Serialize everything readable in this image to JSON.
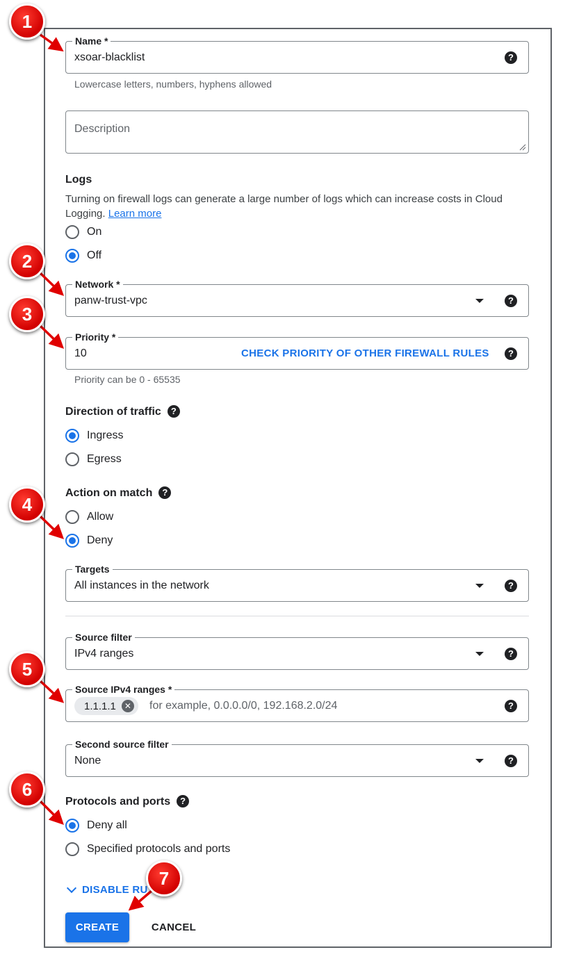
{
  "form": {
    "name": {
      "label": "Name *",
      "value": "xsoar-blacklist",
      "hint": "Lowercase letters, numbers, hyphens allowed"
    },
    "description": {
      "placeholder": "Description"
    },
    "logs": {
      "heading": "Logs",
      "description": "Turning on firewall logs can generate a large number of logs which can increase costs in Cloud Logging.",
      "learn_more": "Learn more",
      "options": [
        "On",
        "Off"
      ],
      "selected": "Off"
    },
    "network": {
      "label": "Network *",
      "value": "panw-trust-vpc"
    },
    "priority": {
      "label": "Priority *",
      "value": "10",
      "check_link": "CHECK PRIORITY OF OTHER FIREWALL RULES",
      "hint": "Priority can be 0 - 65535"
    },
    "direction": {
      "heading": "Direction of traffic",
      "options": [
        "Ingress",
        "Egress"
      ],
      "selected": "Ingress"
    },
    "action": {
      "heading": "Action on match",
      "options": [
        "Allow",
        "Deny"
      ],
      "selected": "Deny"
    },
    "targets": {
      "label": "Targets",
      "value": "All instances in the network"
    },
    "source_filter": {
      "label": "Source filter",
      "value": "IPv4 ranges"
    },
    "source_ranges": {
      "label": "Source IPv4 ranges *",
      "chips": [
        "1.1.1.1"
      ],
      "placeholder": "for example, 0.0.0.0/0, 192.168.2.0/24"
    },
    "second_source_filter": {
      "label": "Second source filter",
      "value": "None"
    },
    "protocols": {
      "heading": "Protocols and ports",
      "options": [
        "Deny all",
        "Specified protocols and ports"
      ],
      "selected": "Deny all"
    },
    "disable_rule_link": "DISABLE RU",
    "buttons": {
      "create": "CREATE",
      "cancel": "CANCEL"
    }
  },
  "icons": {
    "help": "?",
    "chip_remove": "✕"
  },
  "callouts": [
    "1",
    "2",
    "3",
    "4",
    "5",
    "6",
    "7"
  ],
  "colors": {
    "accent": "#1a73e8",
    "callout": "#e00000",
    "text": "#202124"
  }
}
